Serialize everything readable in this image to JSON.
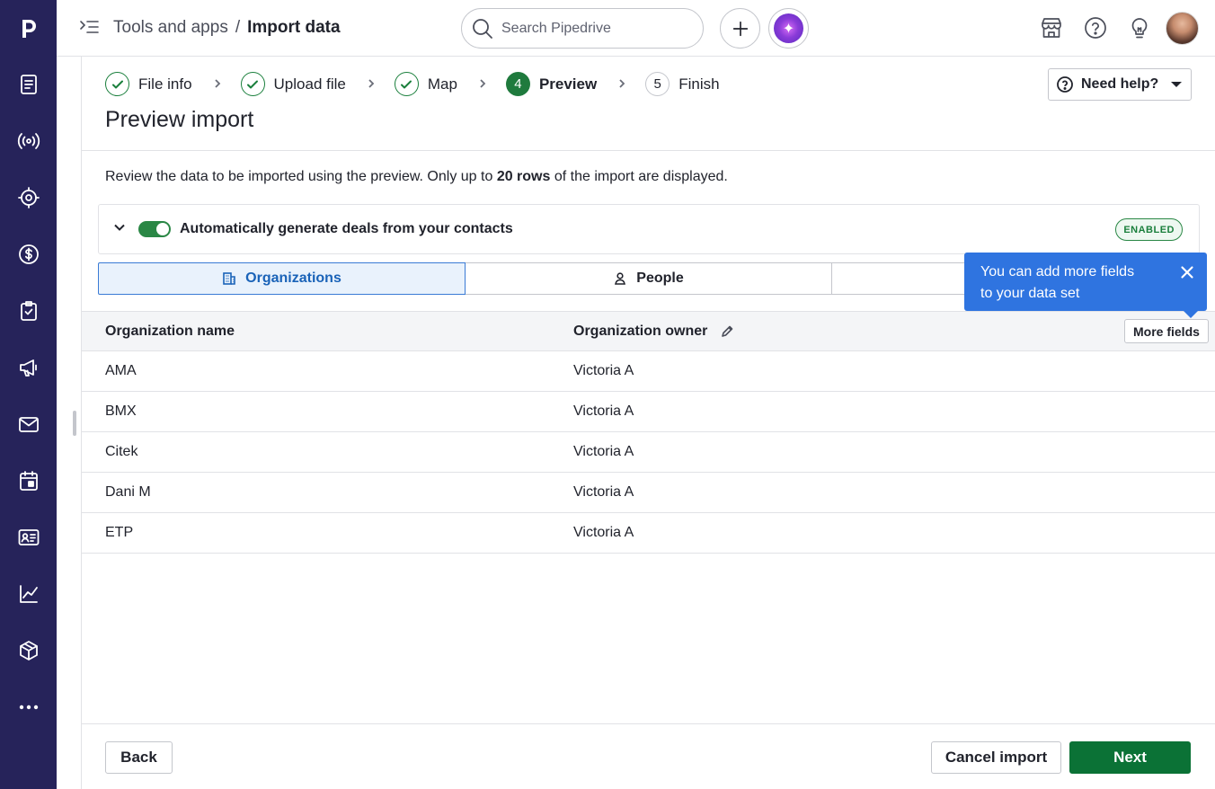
{
  "colors": {
    "rail_bg": "#26235a",
    "accent_green": "#0b7236",
    "tooltip_blue": "#2f74e0",
    "active_tab_blue": "#1a63b8"
  },
  "rail": {
    "logo": "p",
    "items": [
      {
        "icon": "leads-inbox-icon"
      },
      {
        "icon": "broadcast-icon"
      },
      {
        "icon": "target-icon"
      },
      {
        "icon": "dollar-deals-icon"
      },
      {
        "icon": "clipboard-check-icon"
      },
      {
        "icon": "megaphone-icon"
      },
      {
        "icon": "mail-icon"
      },
      {
        "icon": "calendar-icon"
      },
      {
        "icon": "contacts-card-icon"
      },
      {
        "icon": "insights-chart-icon"
      },
      {
        "icon": "products-box-icon"
      },
      {
        "icon": "more-dots-icon"
      }
    ]
  },
  "topbar": {
    "breadcrumb_parent": "Tools and apps",
    "breadcrumb_sep": "/",
    "breadcrumb_current": "Import data",
    "search_placeholder": "Search Pipedrive"
  },
  "steps": [
    {
      "label": "File info",
      "state": "done"
    },
    {
      "label": "Upload file",
      "state": "done"
    },
    {
      "label": "Map",
      "state": "done"
    },
    {
      "number": "4",
      "label": "Preview",
      "state": "active"
    },
    {
      "number": "5",
      "label": "Finish",
      "state": "todo"
    }
  ],
  "help_label": "Need help?",
  "page_title": "Preview import",
  "intro": {
    "before": "Review the data to be imported using the preview. Only up to ",
    "bold": "20 rows",
    "after": " of the import are displayed."
  },
  "autogen": {
    "label": "Automatically generate deals from your contacts",
    "badge": "ENABLED",
    "enabled": true
  },
  "tabs": [
    {
      "label": "Organizations",
      "active": true
    },
    {
      "label": "People",
      "active": false
    },
    {
      "label": "",
      "active": false
    }
  ],
  "tooltip": {
    "line1": "You can add more fields",
    "line2": "to your data set"
  },
  "table": {
    "columns": [
      "Organization name",
      "Organization owner"
    ],
    "more_fields": "More fields",
    "rows": [
      [
        "AMA",
        "Victoria A"
      ],
      [
        "BMX",
        "Victoria A"
      ],
      [
        "Citek",
        "Victoria A"
      ],
      [
        "Dani M",
        "Victoria A"
      ],
      [
        "ETP",
        "Victoria A"
      ]
    ]
  },
  "footer": {
    "back": "Back",
    "cancel": "Cancel import",
    "next": "Next"
  }
}
